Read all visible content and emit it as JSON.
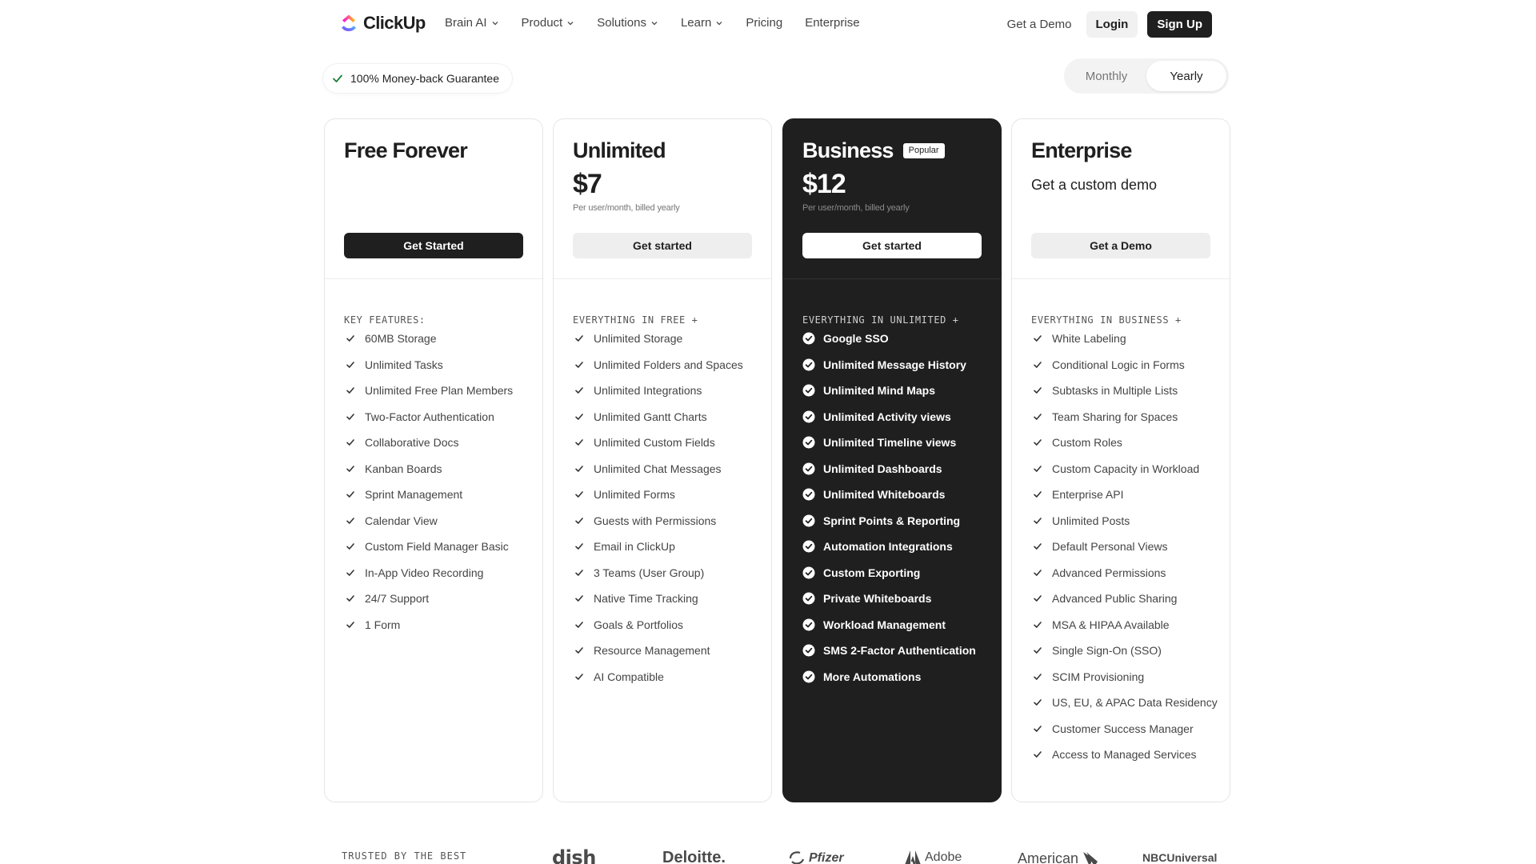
{
  "brand": {
    "name": "ClickUp"
  },
  "nav": {
    "links": [
      {
        "label": "Brain AI",
        "dropdown": true
      },
      {
        "label": "Product",
        "dropdown": true
      },
      {
        "label": "Solutions",
        "dropdown": true
      },
      {
        "label": "Learn",
        "dropdown": true
      },
      {
        "label": "Pricing",
        "dropdown": false
      },
      {
        "label": "Enterprise",
        "dropdown": false
      }
    ],
    "get_demo": "Get a Demo",
    "login": "Login",
    "signup": "Sign Up"
  },
  "guarantee": {
    "label": "100% Money-back Guarantee",
    "icon": "check-icon"
  },
  "billing": {
    "options": [
      "Monthly",
      "Yearly"
    ],
    "selected": "Yearly"
  },
  "plans": [
    {
      "name": "Free Forever",
      "cta": "Get Started",
      "features_heading": "KEY FEATURES:",
      "features": [
        "60MB Storage",
        "Unlimited Tasks",
        "Unlimited Free Plan Members",
        "Two-Factor Authentication",
        "Collaborative Docs",
        "Kanban Boards",
        "Sprint Management",
        "Calendar View",
        "Custom Field Manager Basic",
        "In-App Video Recording",
        "24/7 Support",
        "1 Form"
      ]
    },
    {
      "name": "Unlimited",
      "price": "$7",
      "price_note": "Per user/month, billed yearly",
      "cta": "Get started",
      "features_heading": "EVERYTHING IN FREE +",
      "features": [
        "Unlimited Storage",
        "Unlimited Folders and Spaces",
        "Unlimited Integrations",
        "Unlimited Gantt Charts",
        "Unlimited Custom Fields",
        "Unlimited Chat Messages",
        "Unlimited Forms",
        "Guests with Permissions",
        "Email in ClickUp",
        "3 Teams (User Group)",
        "Native Time Tracking",
        "Goals & Portfolios",
        "Resource Management",
        "AI Compatible"
      ]
    },
    {
      "name": "Business",
      "badge": "Popular",
      "price": "$12",
      "price_note": "Per user/month, billed yearly",
      "cta": "Get started",
      "features_heading": "EVERYTHING IN UNLIMITED +",
      "features": [
        "Google SSO",
        "Unlimited Message History",
        "Unlimited Mind Maps",
        "Unlimited Activity views",
        "Unlimited Timeline views",
        "Unlimited Dashboards",
        "Unlimited Whiteboards",
        "Sprint Points & Reporting",
        "Automation Integrations",
        "Custom Exporting",
        "Private Whiteboards",
        "Workload Management",
        "SMS 2-Factor Authentication",
        "More Automations"
      ]
    },
    {
      "name": "Enterprise",
      "subtitle": "Get a custom demo",
      "cta": "Get a Demo",
      "features_heading": "EVERYTHING IN BUSINESS +",
      "features": [
        "White Labeling",
        "Conditional Logic in Forms",
        "Subtasks in Multiple Lists",
        "Team Sharing for Spaces",
        "Custom Roles",
        "Custom Capacity in Workload",
        "Enterprise API",
        "Unlimited Posts",
        "Default Personal Views",
        "Advanced Permissions",
        "Advanced Public Sharing",
        "MSA & HIPAA Available",
        "Single Sign-On (SSO)",
        "SCIM Provisioning",
        "US, EU, & APAC Data Residency",
        "Customer Success Manager",
        "Access to Managed Services"
      ]
    }
  ],
  "trusted": {
    "label": "TRUSTED BY THE BEST",
    "logos": [
      "dish",
      "Deloitte.",
      "Pfizer",
      "Adobe",
      "American",
      "NBCUniversal"
    ]
  },
  "colors": {
    "dark": "#1f1f1f",
    "check": "#333333",
    "muted": "#777777"
  }
}
